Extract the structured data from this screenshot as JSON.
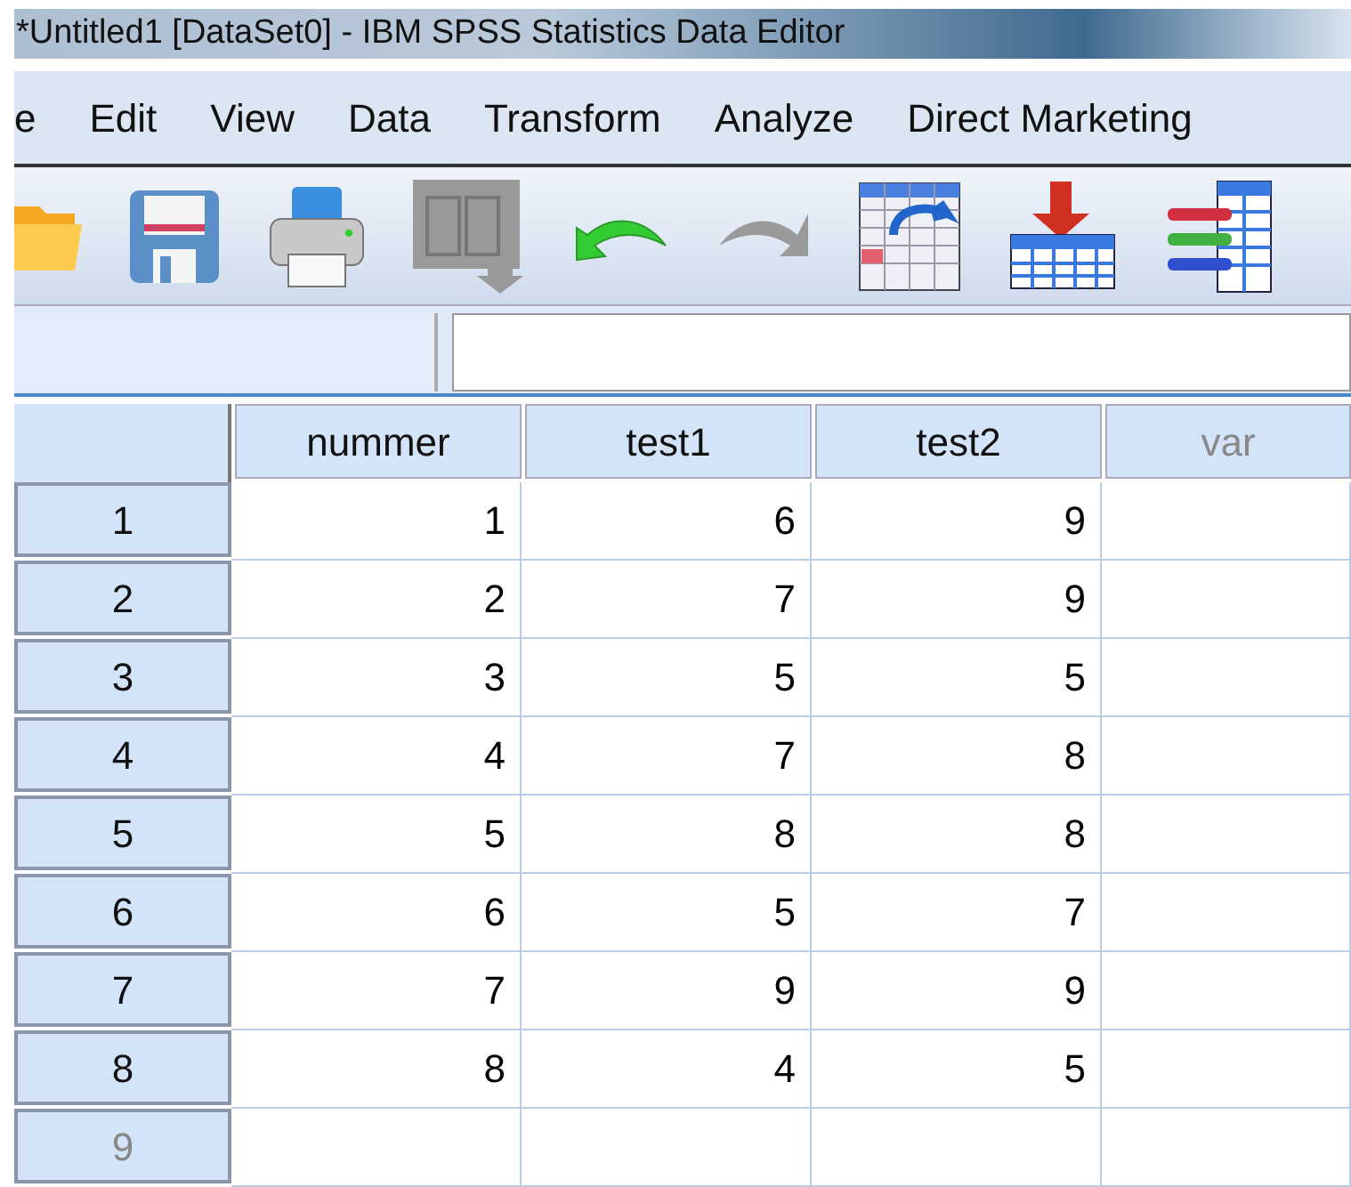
{
  "window": {
    "title": "*Untitled1 [DataSet0] - IBM SPSS Statistics Data Editor"
  },
  "menu": [
    "e",
    "Edit",
    "View",
    "Data",
    "Transform",
    "Analyze",
    "Direct Marketing"
  ],
  "toolbar": [
    {
      "kind": "open",
      "disabled": false
    },
    {
      "kind": "save",
      "disabled": false
    },
    {
      "kind": "print",
      "disabled": false
    },
    {
      "kind": "recall",
      "disabled": true
    },
    {
      "kind": "undo",
      "disabled": false
    },
    {
      "kind": "redo",
      "disabled": true
    },
    {
      "kind": "goto",
      "disabled": false
    },
    {
      "kind": "insert",
      "disabled": false
    },
    {
      "kind": "variables",
      "disabled": false
    }
  ],
  "table": {
    "columns": [
      {
        "label": "nummer",
        "defined": true
      },
      {
        "label": "test1",
        "defined": true
      },
      {
        "label": "test2",
        "defined": true
      },
      {
        "label": "var",
        "defined": false
      }
    ],
    "rows": [
      {
        "label": "1",
        "defined": true,
        "cells": [
          "1",
          "6",
          "9"
        ]
      },
      {
        "label": "2",
        "defined": true,
        "cells": [
          "2",
          "7",
          "9"
        ]
      },
      {
        "label": "3",
        "defined": true,
        "cells": [
          "3",
          "5",
          "5"
        ]
      },
      {
        "label": "4",
        "defined": true,
        "cells": [
          "4",
          "7",
          "8"
        ]
      },
      {
        "label": "5",
        "defined": true,
        "cells": [
          "5",
          "8",
          "8"
        ]
      },
      {
        "label": "6",
        "defined": true,
        "cells": [
          "6",
          "5",
          "7"
        ]
      },
      {
        "label": "7",
        "defined": true,
        "cells": [
          "7",
          "9",
          "9"
        ]
      },
      {
        "label": "8",
        "defined": true,
        "cells": [
          "8",
          "4",
          "5"
        ]
      },
      {
        "label": "9",
        "defined": false,
        "cells": []
      }
    ]
  }
}
